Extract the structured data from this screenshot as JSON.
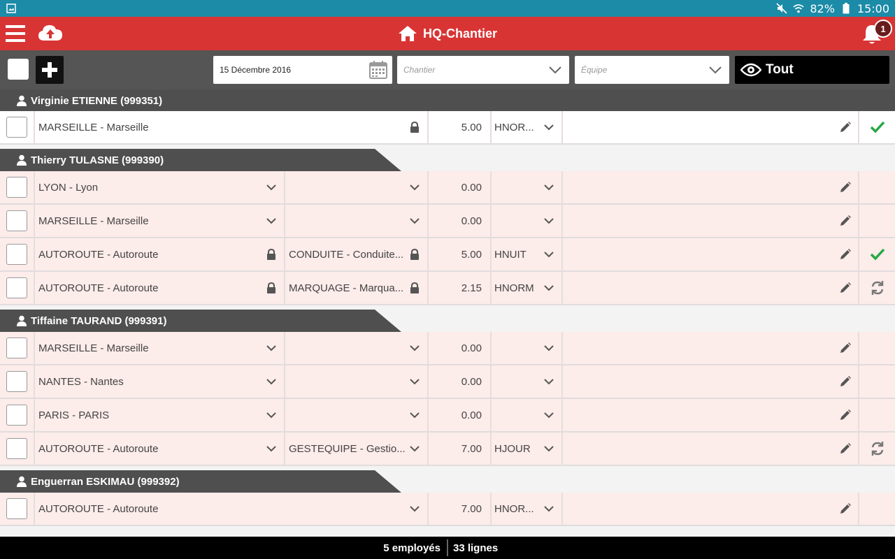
{
  "status_bar": {
    "battery": "82%",
    "time": "15:00",
    "icons": [
      "gallery-icon",
      "mute-icon",
      "wifi-icon",
      "battery-icon"
    ]
  },
  "app_bar": {
    "title": "HQ-Chantier",
    "notification_count": "1",
    "color": "#d93434",
    "icons": [
      "menu-icon",
      "cloud-upload-icon",
      "home-icon",
      "bell-icon"
    ]
  },
  "toolbar": {
    "date": "15 Décembre 2016",
    "chantier_placeholder": "Chantier",
    "equipe_placeholder": "Équipe",
    "view_label": "Tout"
  },
  "employees": [
    {
      "name": "Virginie ETIENNE (999351)",
      "rows": [
        {
          "site": "MARSEILLE - Marseille",
          "site_icon": "lock-icon",
          "task": "",
          "task_icon": "",
          "hours": "5.00",
          "type": "HNOR...",
          "status": "check-icon"
        }
      ]
    },
    {
      "name": "Thierry TULASNE (999390)",
      "rows": [
        {
          "site": "LYON - Lyon",
          "site_icon": "chevron-down-icon",
          "task": "",
          "task_icon": "chevron-down-icon",
          "hours": "0.00",
          "type": "",
          "status": ""
        },
        {
          "site": "MARSEILLE - Marseille",
          "site_icon": "chevron-down-icon",
          "task": "",
          "task_icon": "chevron-down-icon",
          "hours": "0.00",
          "type": "",
          "status": ""
        },
        {
          "site": "AUTOROUTE - Autoroute",
          "site_icon": "lock-icon",
          "task": "CONDUITE - Conduite...",
          "task_icon": "lock-icon",
          "hours": "5.00",
          "type": "HNUIT",
          "status": "check-icon"
        },
        {
          "site": "AUTOROUTE - Autoroute",
          "site_icon": "lock-icon",
          "task": "MARQUAGE - Marqua...",
          "task_icon": "lock-icon",
          "hours": "2.15",
          "type": "HNORM",
          "status": "sync-icon"
        }
      ]
    },
    {
      "name": "Tiffaine TAURAND (999391)",
      "rows": [
        {
          "site": "MARSEILLE - Marseille",
          "site_icon": "chevron-down-icon",
          "task": "",
          "task_icon": "chevron-down-icon",
          "hours": "0.00",
          "type": "",
          "status": ""
        },
        {
          "site": "NANTES - Nantes",
          "site_icon": "chevron-down-icon",
          "task": "",
          "task_icon": "chevron-down-icon",
          "hours": "0.00",
          "type": "",
          "status": ""
        },
        {
          "site": "PARIS - PARIS",
          "site_icon": "chevron-down-icon",
          "task": "",
          "task_icon": "chevron-down-icon",
          "hours": "0.00",
          "type": "",
          "status": ""
        },
        {
          "site": "AUTOROUTE - Autoroute",
          "site_icon": "chevron-down-icon",
          "task": "GESTEQUIPE - Gestio...",
          "task_icon": "chevron-down-icon",
          "hours": "7.00",
          "type": "HJOUR",
          "status": "sync-icon"
        }
      ]
    },
    {
      "name": "Enguerran ESKIMAU (999392)",
      "rows": [
        {
          "site": "AUTOROUTE - Autoroute",
          "site_icon": "chevron-down-icon",
          "task": "",
          "task_icon": "",
          "hours": "7.00",
          "type": "HNOR...",
          "status": ""
        }
      ]
    }
  ],
  "footer": {
    "employees": "5 employés",
    "lines": "33 lignes"
  }
}
